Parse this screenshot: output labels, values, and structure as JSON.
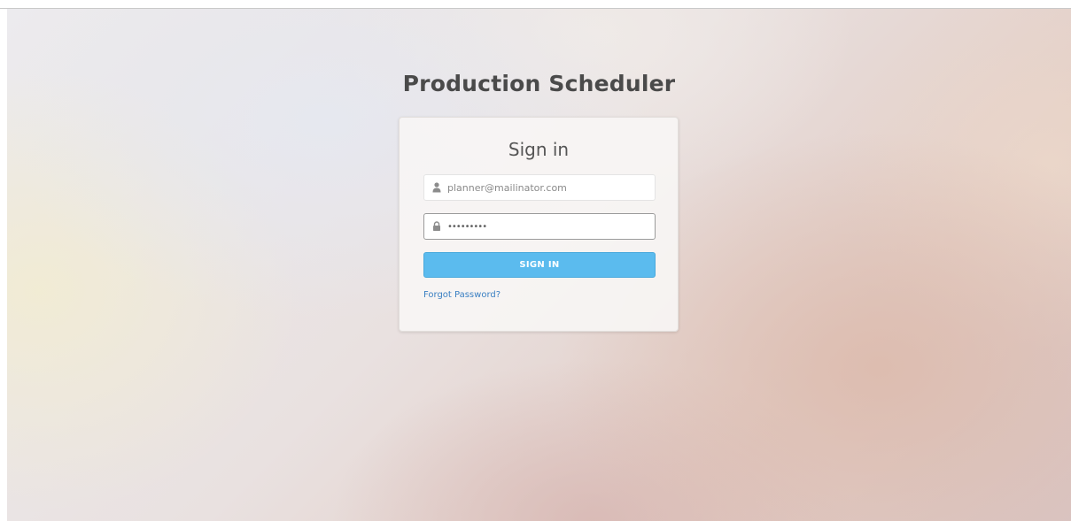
{
  "app": {
    "title": "Production Scheduler"
  },
  "login": {
    "heading": "Sign in",
    "email": {
      "value": "planner@mailinator.com",
      "icon": "user-icon"
    },
    "password": {
      "value": "•••••••••",
      "icon": "lock-icon"
    },
    "submit_label": "SIGN IN",
    "forgot_label": "Forgot Password?"
  },
  "colors": {
    "accent": "#5bbbee",
    "link": "#3a7fc2",
    "title_text": "#4a4a4a"
  }
}
